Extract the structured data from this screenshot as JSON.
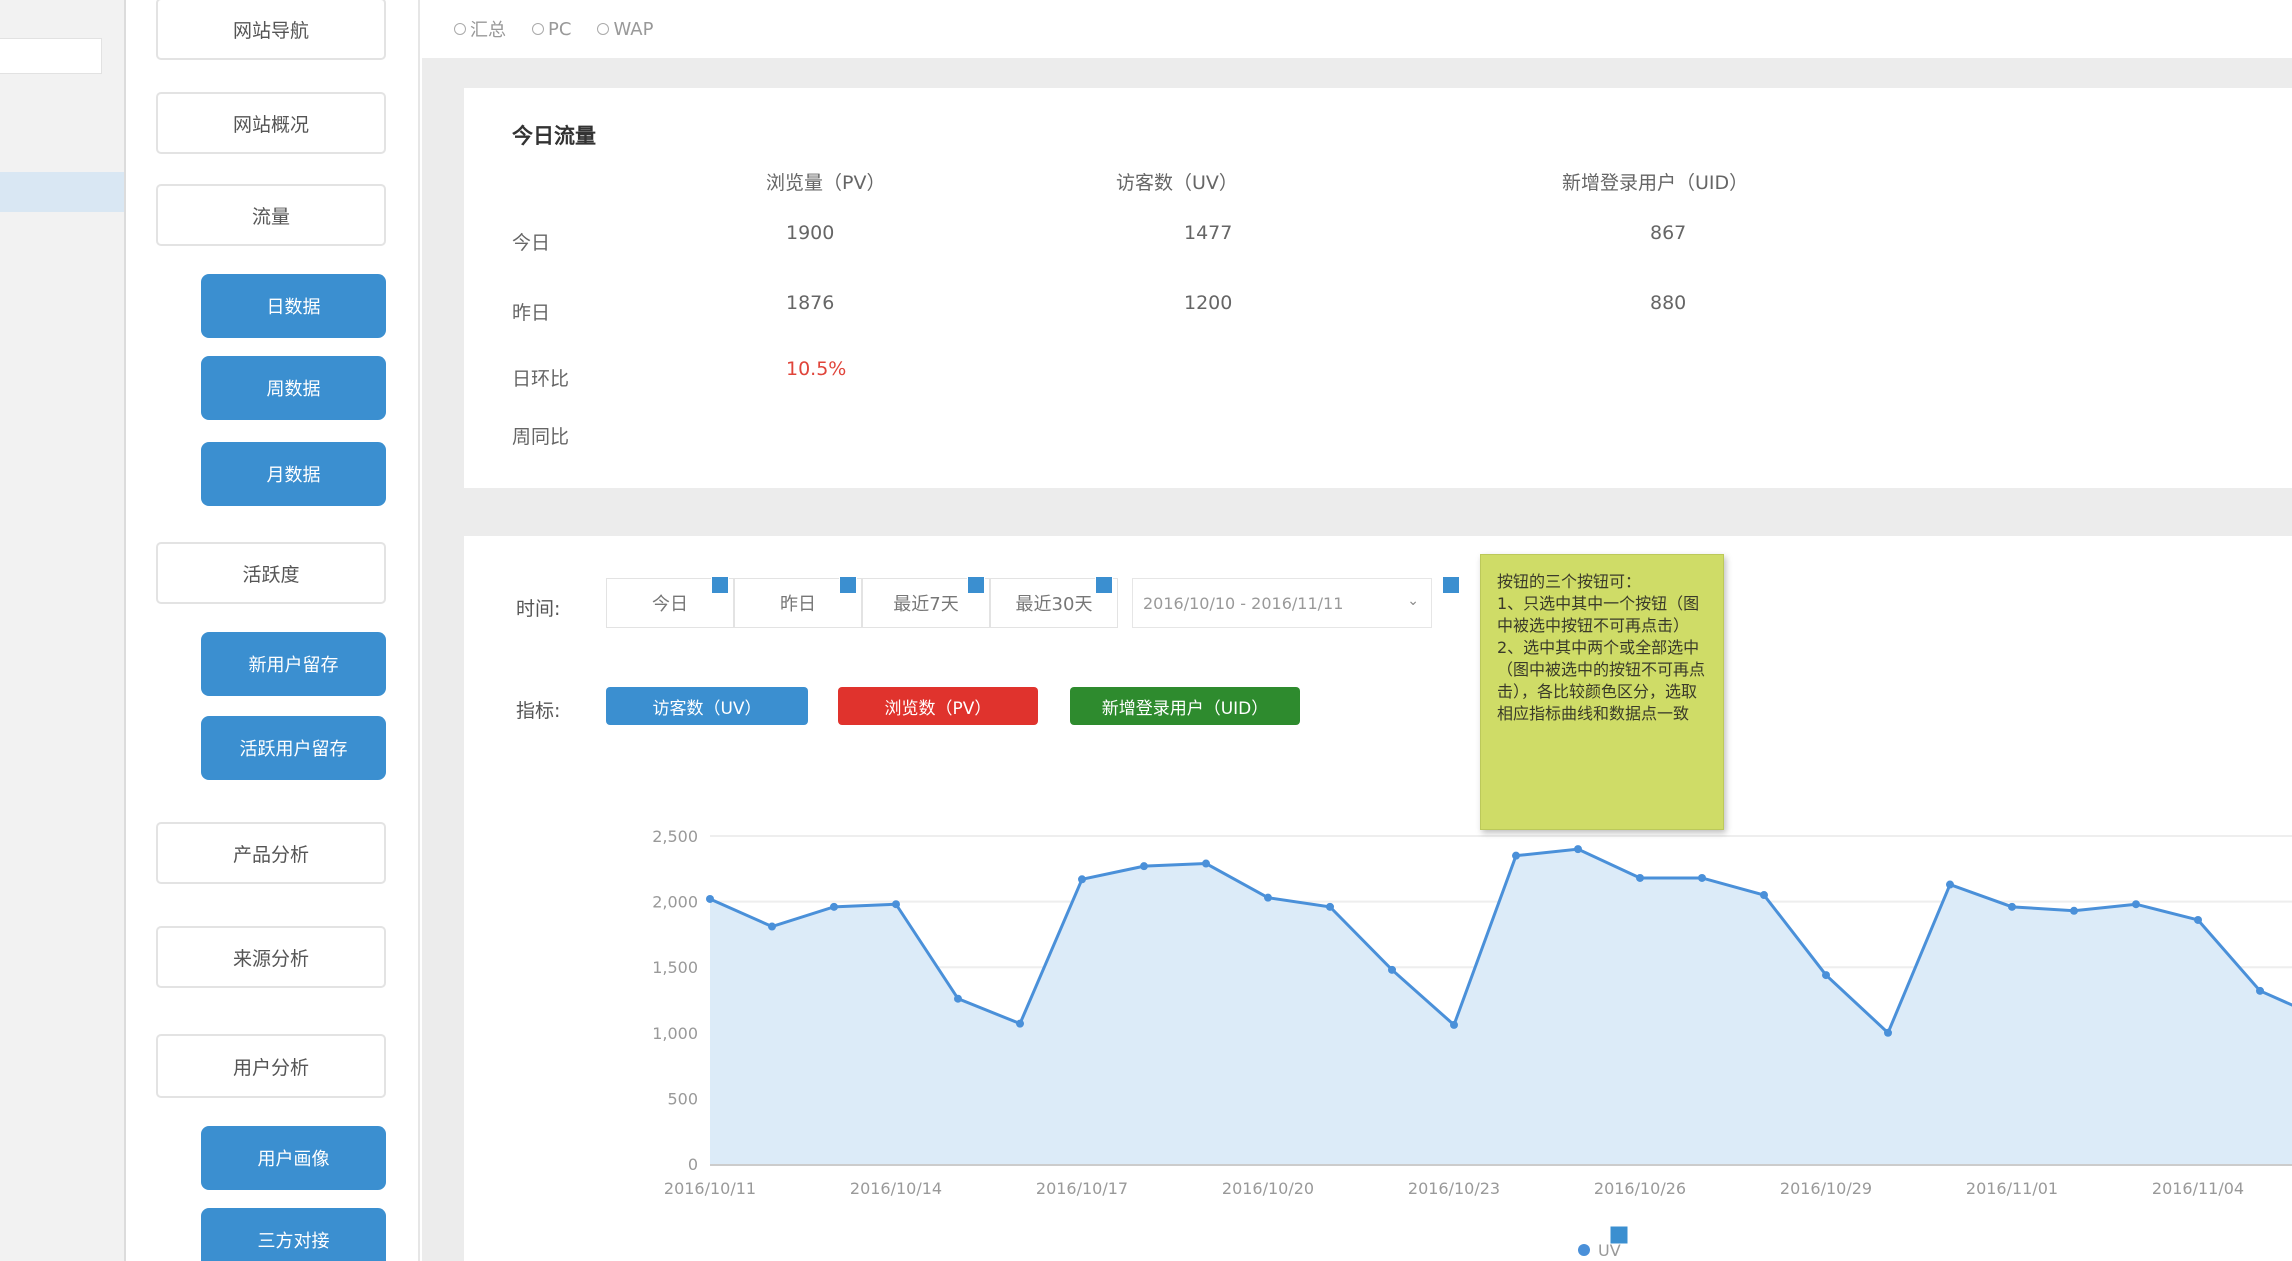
{
  "platform_filter": {
    "options": [
      "汇总",
      "PC",
      "WAP"
    ]
  },
  "menu": {
    "items": [
      {
        "id": "site-nav",
        "label": "网站导航",
        "type": "group"
      },
      {
        "id": "site-overview",
        "label": "网站概况",
        "type": "group"
      },
      {
        "id": "traffic",
        "label": "流量",
        "type": "group"
      },
      {
        "id": "daily",
        "label": "日数据",
        "type": "sub"
      },
      {
        "id": "weekly",
        "label": "周数据",
        "type": "sub"
      },
      {
        "id": "monthly",
        "label": "月数据",
        "type": "sub"
      },
      {
        "id": "loyalty",
        "label": "活跃度",
        "type": "group"
      },
      {
        "id": "new-user-retention",
        "label": "新用户留存",
        "type": "sub"
      },
      {
        "id": "active-user-retention",
        "label": "活跃用户留存",
        "type": "sub"
      },
      {
        "id": "product-analysis",
        "label": "产品分析",
        "type": "group"
      },
      {
        "id": "source-analysis",
        "label": "来源分析",
        "type": "group"
      },
      {
        "id": "user-analysis",
        "label": "用户分析",
        "type": "group"
      },
      {
        "id": "user-profile",
        "label": "用户画像",
        "type": "sub"
      },
      {
        "id": "third-party",
        "label": "三方对接",
        "type": "sub"
      }
    ]
  },
  "today_panel": {
    "title": "今日流量",
    "columns": [
      "浏览量（PV）",
      "访客数（UV）",
      "新增登录用户（UID）"
    ],
    "rows": [
      {
        "label": "今日",
        "values": [
          "1900",
          "1477",
          "867"
        ]
      },
      {
        "label": "昨日",
        "values": [
          "1876",
          "1200",
          "880"
        ]
      },
      {
        "label": "日环比",
        "values": [
          "10.5%",
          "",
          ""
        ]
      },
      {
        "label": "周同比",
        "values": [
          "",
          "",
          ""
        ]
      }
    ],
    "highlight_color": "#e0443a"
  },
  "chart_panel": {
    "time_label": "时间:",
    "time_ranges": [
      "今日",
      "昨日",
      "最近7天",
      "最近30天"
    ],
    "date_range": "2016/10/10 - 2016/11/11",
    "metric_label": "指标:",
    "metrics": [
      {
        "label": "访客数（UV）",
        "color": "#3b8fd0"
      },
      {
        "label": "浏览数（PV）",
        "color": "#e0332d"
      },
      {
        "label": "新增登录用户（UID）",
        "color": "#2e8b2e"
      }
    ],
    "note": "按钮的三个按钮可：\n1、只选中其中一个按钮（图中被选中按钮不可再点击）\n2、选中其中两个或全部选中（图中被选中的按钮不可再点击），各比较颜色区分，选取相应指标曲线和数据点一致"
  },
  "chart_data": {
    "type": "area",
    "series": [
      {
        "name": "UV",
        "color": "#4a90d9",
        "values": [
          2020,
          1810,
          1960,
          1980,
          1260,
          1070,
          2170,
          2270,
          2290,
          2030,
          1960,
          1480,
          1060,
          2350,
          2400,
          2180,
          2180,
          2050,
          1440,
          1000,
          2130,
          1960,
          1930,
          1980,
          1860,
          1320,
          1110
        ]
      }
    ],
    "ylim": [
      0,
      2500
    ],
    "y_ticks": [
      "0",
      "500",
      "1,000",
      "1,500",
      "2,000",
      "2,500"
    ],
    "x_ticks": [
      "2016/10/11",
      "2016/10/14",
      "2016/10/17",
      "2016/10/20",
      "2016/10/23",
      "2016/10/26",
      "2016/10/29",
      "2016/11/01",
      "2016/11/04"
    ],
    "legend": "bottom-center",
    "grid": true
  }
}
